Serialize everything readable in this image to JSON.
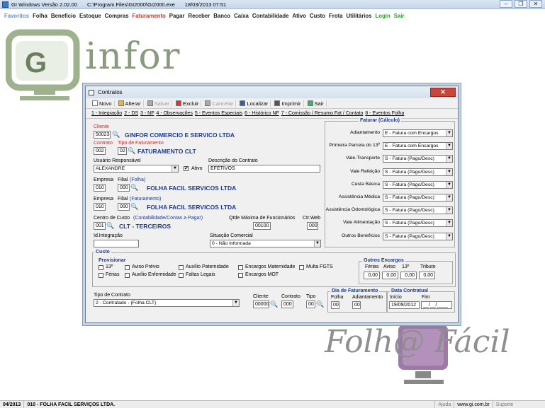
{
  "app": {
    "title": "GI Windows  Versão  2.02.00",
    "path": "C:\\Program Files\\GI2000\\GI2000.exe",
    "datetime": "18/03/2013 07:51"
  },
  "menu": [
    "Favoritos",
    "Folha",
    "Benefício",
    "Estoque",
    "Compras",
    "Faturamento",
    "Pagar",
    "Receber",
    "Banco",
    "Caixa",
    "Contabilidade",
    "Ativo",
    "Custo",
    "Frota",
    "Utilitários",
    "Login",
    "Sair"
  ],
  "logo": {
    "infor": "infor",
    "folha": "Folh@ Fácil"
  },
  "status": {
    "period": "04/2013",
    "company": "010 - FOLHA FACIL SERVIÇOS LTDA.",
    "help": "Ajuda",
    "site": "www.gi.com.br",
    "support": "Suporte"
  },
  "dialog": {
    "title": "Contratos",
    "toolbar": [
      "Novo",
      "Alterar",
      "Salvar",
      "Excluir",
      "Cancelar",
      "Localizar",
      "Imprimir",
      "Sair"
    ],
    "tabs": [
      "1 - Integração",
      "2 - DS",
      "3 - NF",
      "4 - Observações",
      "5 - Eventos Especiais",
      "6 - Histórico NF",
      "7 - Comissão / Resumo Fat / Contato",
      "8 - Eventos Folha"
    ],
    "cliente": {
      "label": "Cliente",
      "code": "50023",
      "name": "GINFOR COMERCIO E SERVICO LTDA"
    },
    "contrato": {
      "label": "Contrato",
      "value": "002",
      "tipo_label": "Tipo de Faturamento",
      "tipo_code": "02",
      "tipo_name": "FATURAMENTO CLT"
    },
    "usuario": {
      "label": "Usuário Responsável",
      "value": "ALEXANDRE",
      "ativo": "Ativo"
    },
    "descricao": {
      "label": "Descrição do Contrato",
      "value": "EFETIVOS"
    },
    "empresa_folha": {
      "emp_label": "Empresa",
      "filial_label": "Filial",
      "extra": "(Folha)",
      "emp": "010",
      "filial": "000",
      "name": "FOLHA FACIL SERVICOS LTDA"
    },
    "empresa_fat": {
      "emp_label": "Empresa",
      "filial_label": "Filial",
      "extra": "(Faturamento)",
      "emp": "010",
      "filial": "000",
      "name": "FOLHA FACIL SERVICOS LTDA"
    },
    "centro": {
      "label": "Centro de Custo",
      "extra": "(Contabilidade/Contas a Pagar)",
      "code": "001",
      "name": "CLT - TERCEIROS"
    },
    "qtde": {
      "label": "Qtde Máxima de Funcionários",
      "value": "00100"
    },
    "ctrweb": {
      "label": "Ctr.Web",
      "value": "000"
    },
    "integracao": {
      "label": "Id.Integração",
      "value": ""
    },
    "situacao": {
      "label": "Situação Comercial",
      "value": "0 - Não Informada"
    },
    "faturar": {
      "title": "Faturar (Cálculo)",
      "rows": [
        {
          "label": "Adiantamento",
          "value": "E - Fatura com Encargos"
        },
        {
          "label": "Primeira Parcela do 13º",
          "value": "E - Fatura com Encargos"
        },
        {
          "label": "Vale-Transporte",
          "value": "S - Fatura (Pago/Desc)"
        },
        {
          "label": "Vale Refeição",
          "value": "S - Fatura (Pago/Desc)"
        },
        {
          "label": "Cesta Básica",
          "value": "S - Fatura (Pago/Desc)"
        },
        {
          "label": "Assistência Médica",
          "value": "S - Fatura (Pago/Desc)"
        },
        {
          "label": "Assistência Odontológica",
          "value": "S - Fatura (Pago/Desc)"
        },
        {
          "label": "Vale Alimentação",
          "value": "S - Fatura (Pago/Desc)"
        },
        {
          "label": "Outros Benefícios",
          "value": "S - Fatura (Pago/Desc)"
        }
      ]
    },
    "custo": {
      "title": "Custo",
      "provisionar": "Provisionar",
      "checks": [
        "13º",
        "Aviso Prévio",
        "Auxílio Paternidade",
        "Encargos Maternidade",
        "Multa FGTS",
        "Férias",
        "Auxílio Enfermidade",
        "Faltas Legais",
        "Encargos MOT"
      ],
      "outros": {
        "title": "Outros Encargos",
        "cols": [
          "Férias",
          "Aviso",
          "13º",
          "Tributo"
        ],
        "values": [
          "0,00",
          "0,00",
          "0,00",
          "0,00"
        ]
      }
    },
    "tipo_contrato": {
      "label": "Tipo de Contrato",
      "value": "2 - Contratado - (Folha CLT)"
    },
    "bottom": {
      "cliente_label": "Cliente",
      "cliente": "00000",
      "contrato_label": "Contrato",
      "contrato": "000",
      "tipo_label": "Tipo",
      "tipo": "00"
    },
    "dia": {
      "title": "Dia de Faturamento",
      "folha_label": "Folha",
      "folha": "00",
      "adiant_label": "Adiantamento",
      "adiant": "00"
    },
    "data": {
      "title": "Data Contratual",
      "inicio_label": "Início",
      "inicio": "19/09/2012",
      "fim_label": "Fim",
      "fim": "__/__/____"
    }
  }
}
